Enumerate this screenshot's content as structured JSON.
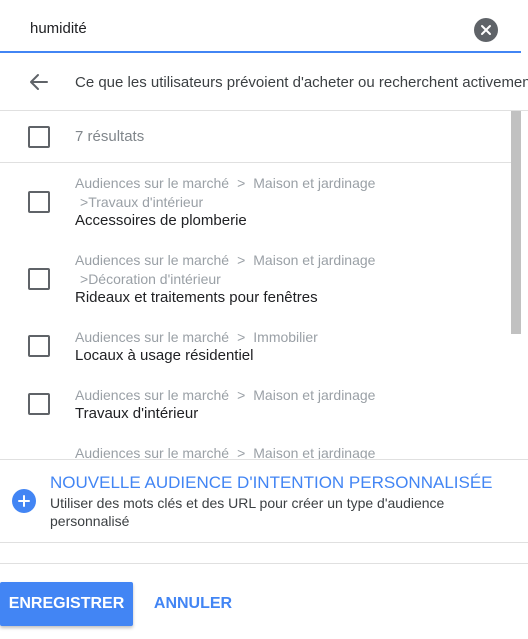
{
  "search": {
    "value": "humidité"
  },
  "nav": {
    "description": "Ce que les utilisateurs prévoient d'acheter ou recherchent activement"
  },
  "results": {
    "count_label": "7 résultats",
    "items": [
      {
        "crumb": [
          "Audiences sur le marché",
          "Maison et jardinage"
        ],
        "crumb2": "Travaux d'intérieur",
        "title": "Accessoires de plomberie"
      },
      {
        "crumb": [
          "Audiences sur le marché",
          "Maison et jardinage"
        ],
        "crumb2": "Décoration d'intérieur",
        "title": "Rideaux et traitements pour fenêtres"
      },
      {
        "crumb": [
          "Audiences sur le marché",
          "Immobilier"
        ],
        "title": "Locaux à usage résidentiel"
      },
      {
        "crumb": [
          "Audiences sur le marché",
          "Maison et jardinage"
        ],
        "title": "Travaux d'intérieur"
      },
      {
        "crumb": [
          "Audiences sur le marché",
          "Maison et jardinage"
        ]
      }
    ]
  },
  "custom_audience": {
    "title": "NOUVELLE AUDIENCE D'INTENTION PERSONNALISÉE",
    "description": "Utiliser des mots clés et des URL pour créer un type d'audience personnalisé"
  },
  "footer": {
    "save_label": "ENREGISTRER",
    "cancel_label": "ANNULER"
  },
  "icons": {
    "clear": "clear-circle-icon",
    "back": "arrow-back-icon",
    "add": "add-circle-icon"
  },
  "colors": {
    "accent": "#4285f4",
    "muted_text": "#9aa0a6"
  }
}
